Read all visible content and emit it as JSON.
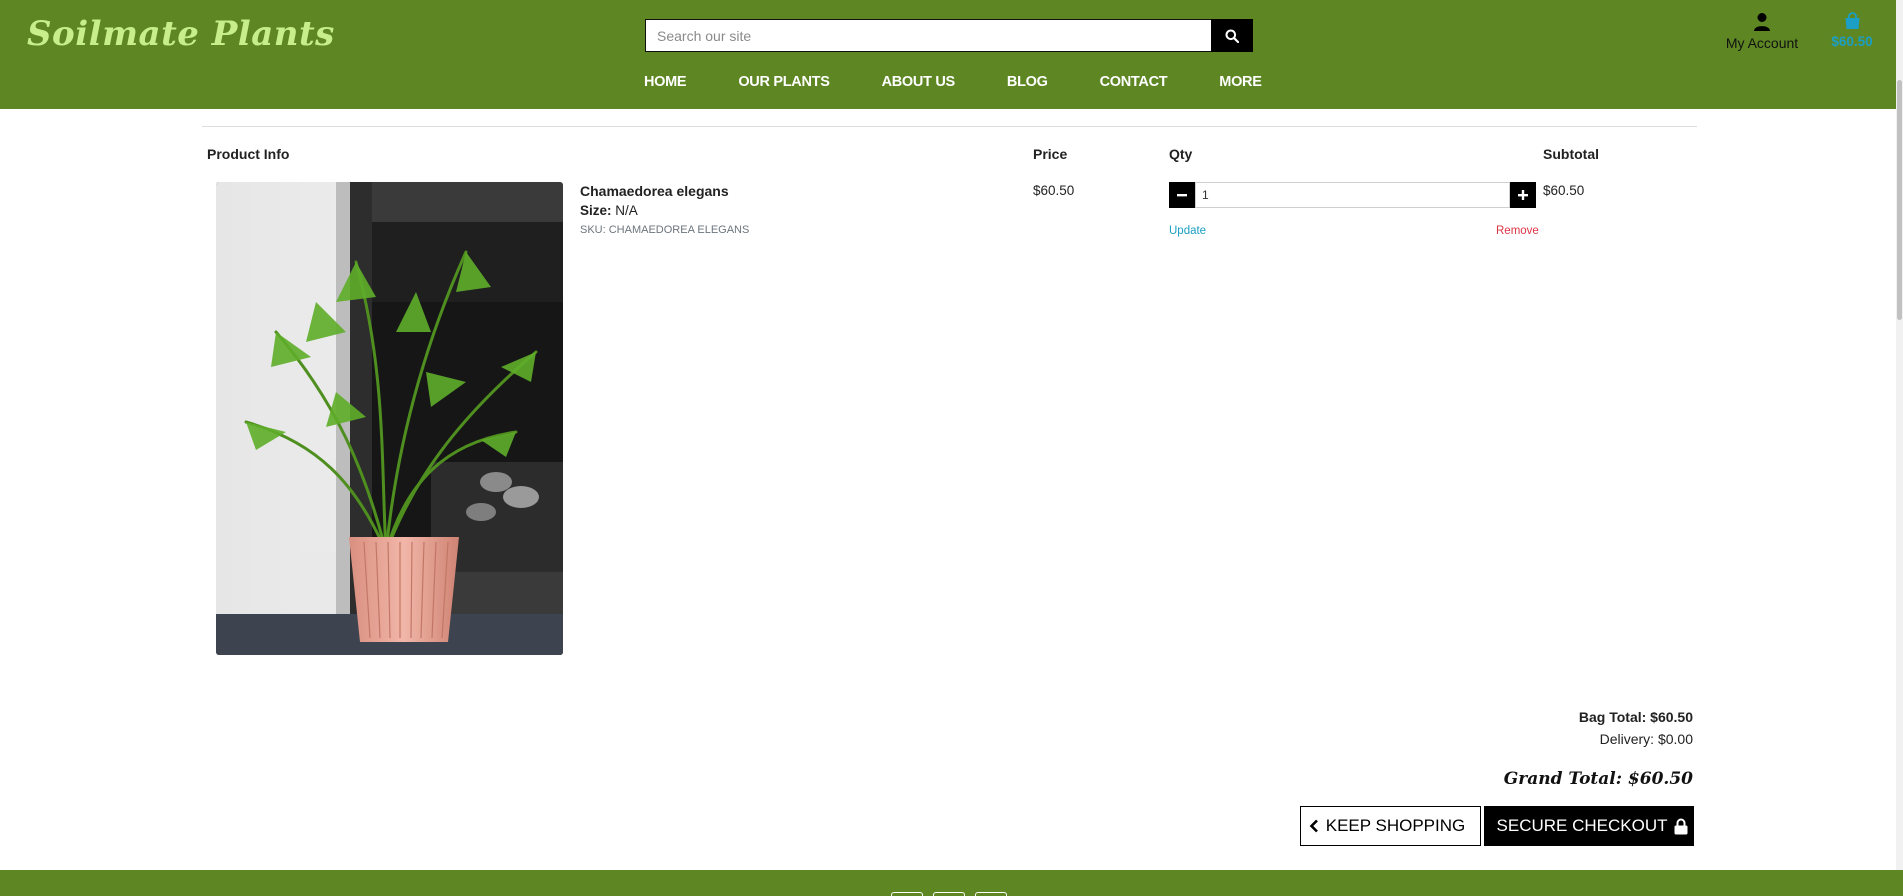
{
  "header": {
    "brand": "Soilmate Plants",
    "search": {
      "placeholder": "Search our site",
      "icon": "search-icon"
    },
    "nav": [
      "HOME",
      "OUR PLANTS",
      "ABOUT US",
      "BLOG",
      "CONTACT",
      "MORE"
    ],
    "account": {
      "label": "My Account",
      "icon": "user-icon"
    },
    "bag": {
      "total": "$60.50",
      "icon": "shopping-bag-icon"
    }
  },
  "table": {
    "headers": {
      "product_info": "Product Info",
      "price": "Price",
      "qty": "Qty",
      "subtotal": "Subtotal"
    },
    "item": {
      "name": "Chamaedorea elegans",
      "size_label": "Size:",
      "size_value": "N/A",
      "sku": "SKU: CHAMAEDOREA ELEGANS",
      "price": "$60.50",
      "qty": "1",
      "subtotal": "$60.50",
      "update_label": "Update",
      "remove_label": "Remove"
    }
  },
  "totals": {
    "bag_total": "Bag Total: $60.50",
    "delivery": "Delivery: $0.00",
    "grand_total": "Grand Total: $60.50"
  },
  "buttons": {
    "keep_shopping": "KEEP SHOPPING",
    "secure_checkout": "SECURE CHECKOUT"
  },
  "colors": {
    "header_bg": "#5e8724",
    "brand": "#c7ee8a",
    "bag_total": "#1c9fc4",
    "remove": "#dc3545"
  }
}
